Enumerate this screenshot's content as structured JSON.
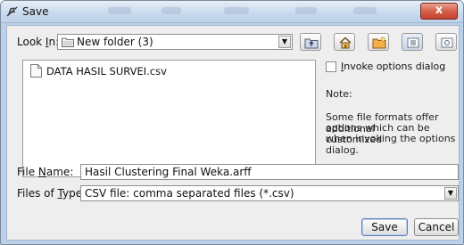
{
  "window": {
    "title": "Save",
    "close_label": "x"
  },
  "look_in": {
    "label_pre": "Look ",
    "label_mn": "I",
    "label_post": "n:",
    "value": "New folder (3)"
  },
  "toolbar": {
    "icons": [
      "up-folder-icon",
      "home-icon",
      "new-folder-icon",
      "list-view-icon",
      "details-view-icon"
    ]
  },
  "files": [
    {
      "name": "DATA HASIL SURVEI.csv",
      "icon": "file-icon"
    }
  ],
  "options": {
    "invoke_mn": "I",
    "invoke_rest": "nvoke options dialog",
    "note_title": "Note:",
    "note_lines": [
      "Some file formats offer additional",
      "options which can be customized",
      "when invoking the options dialog."
    ]
  },
  "file_name": {
    "label_pre": "File ",
    "label_mn": "N",
    "label_post": "ame:",
    "value": "Hasil Clustering Final Weka.arff"
  },
  "file_type": {
    "label_pre": "Files of ",
    "label_mn": "T",
    "label_post": "ype:",
    "value": "CSV file: comma separated files (*.csv)"
  },
  "buttons": {
    "save": "Save",
    "cancel": "Cancel"
  },
  "colors": {
    "titlebar": "#c8d9ee",
    "dialog_bg": "#eeeeee",
    "close_button": "#d5604a"
  }
}
